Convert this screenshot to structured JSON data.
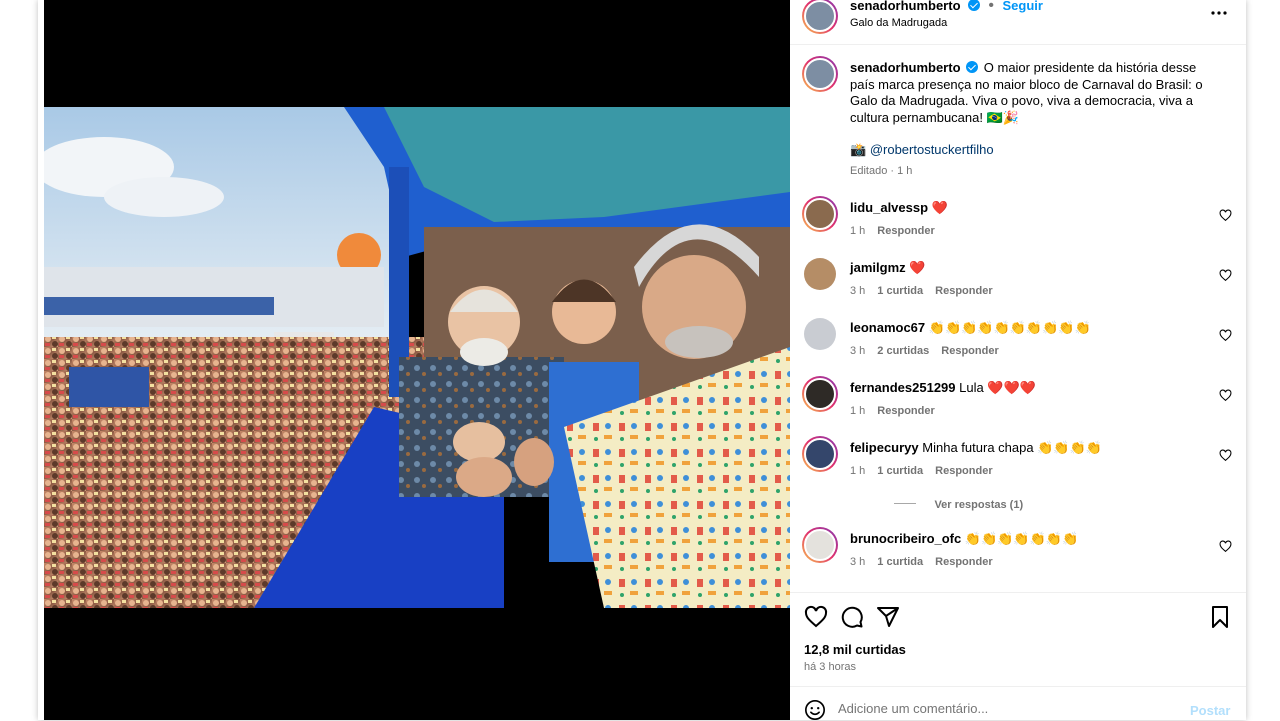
{
  "post": {
    "username": "senadorhumberto",
    "follow_label": "Seguir",
    "location": "Galo da Madrugada",
    "more_icon": "more-horizontal-icon"
  },
  "caption": {
    "username": "senadorhumberto",
    "text": "O maior presidente da história desse país marca presença no maior bloco de Carnaval do Brasil: o Galo da Madrugada. Viva o povo, viva a democracia, viva a cultura pernambucana! 🇧🇷🎉",
    "credit_icon": "📸",
    "credit": "@robertostuckertfilho",
    "edited": "Editado · 1 h"
  },
  "comments": [
    {
      "user": "lidu_alvessp",
      "text": "❤️",
      "time": "1 h",
      "likes": "",
      "reply": "Responder"
    },
    {
      "user": "jamilgmz",
      "text": "❤️",
      "time": "3 h",
      "likes": "1 curtida",
      "reply": "Responder"
    },
    {
      "user": "leonamoc67",
      "text": "👏👏👏👏👏👏👏👏👏👏",
      "time": "3 h",
      "likes": "2 curtidas",
      "reply": "Responder"
    },
    {
      "user": "fernandes251299",
      "text": "Lula ❤️❤️❤️",
      "time": "1 h",
      "likes": "",
      "reply": "Responder"
    },
    {
      "user": "felipecuryy",
      "text": "Minha futura chapa 👏👏👏👏",
      "time": "1 h",
      "likes": "1 curtida",
      "reply": "Responder"
    },
    {
      "user": "brunocribeiro_ofc",
      "text": "👏👏👏👏👏👏👏",
      "time": "3 h",
      "likes": "1 curtida",
      "reply": "Responder"
    }
  ],
  "view_replies": "Ver respostas (1)",
  "stats": {
    "likes": "12,8 mil curtidas",
    "posted": "há 3 horas"
  },
  "add_comment": {
    "placeholder": "Adicione um comentário...",
    "post_label": "Postar"
  },
  "colors": {
    "accent": "#0095f6",
    "heart": "#ed4956",
    "muted": "#737373"
  }
}
